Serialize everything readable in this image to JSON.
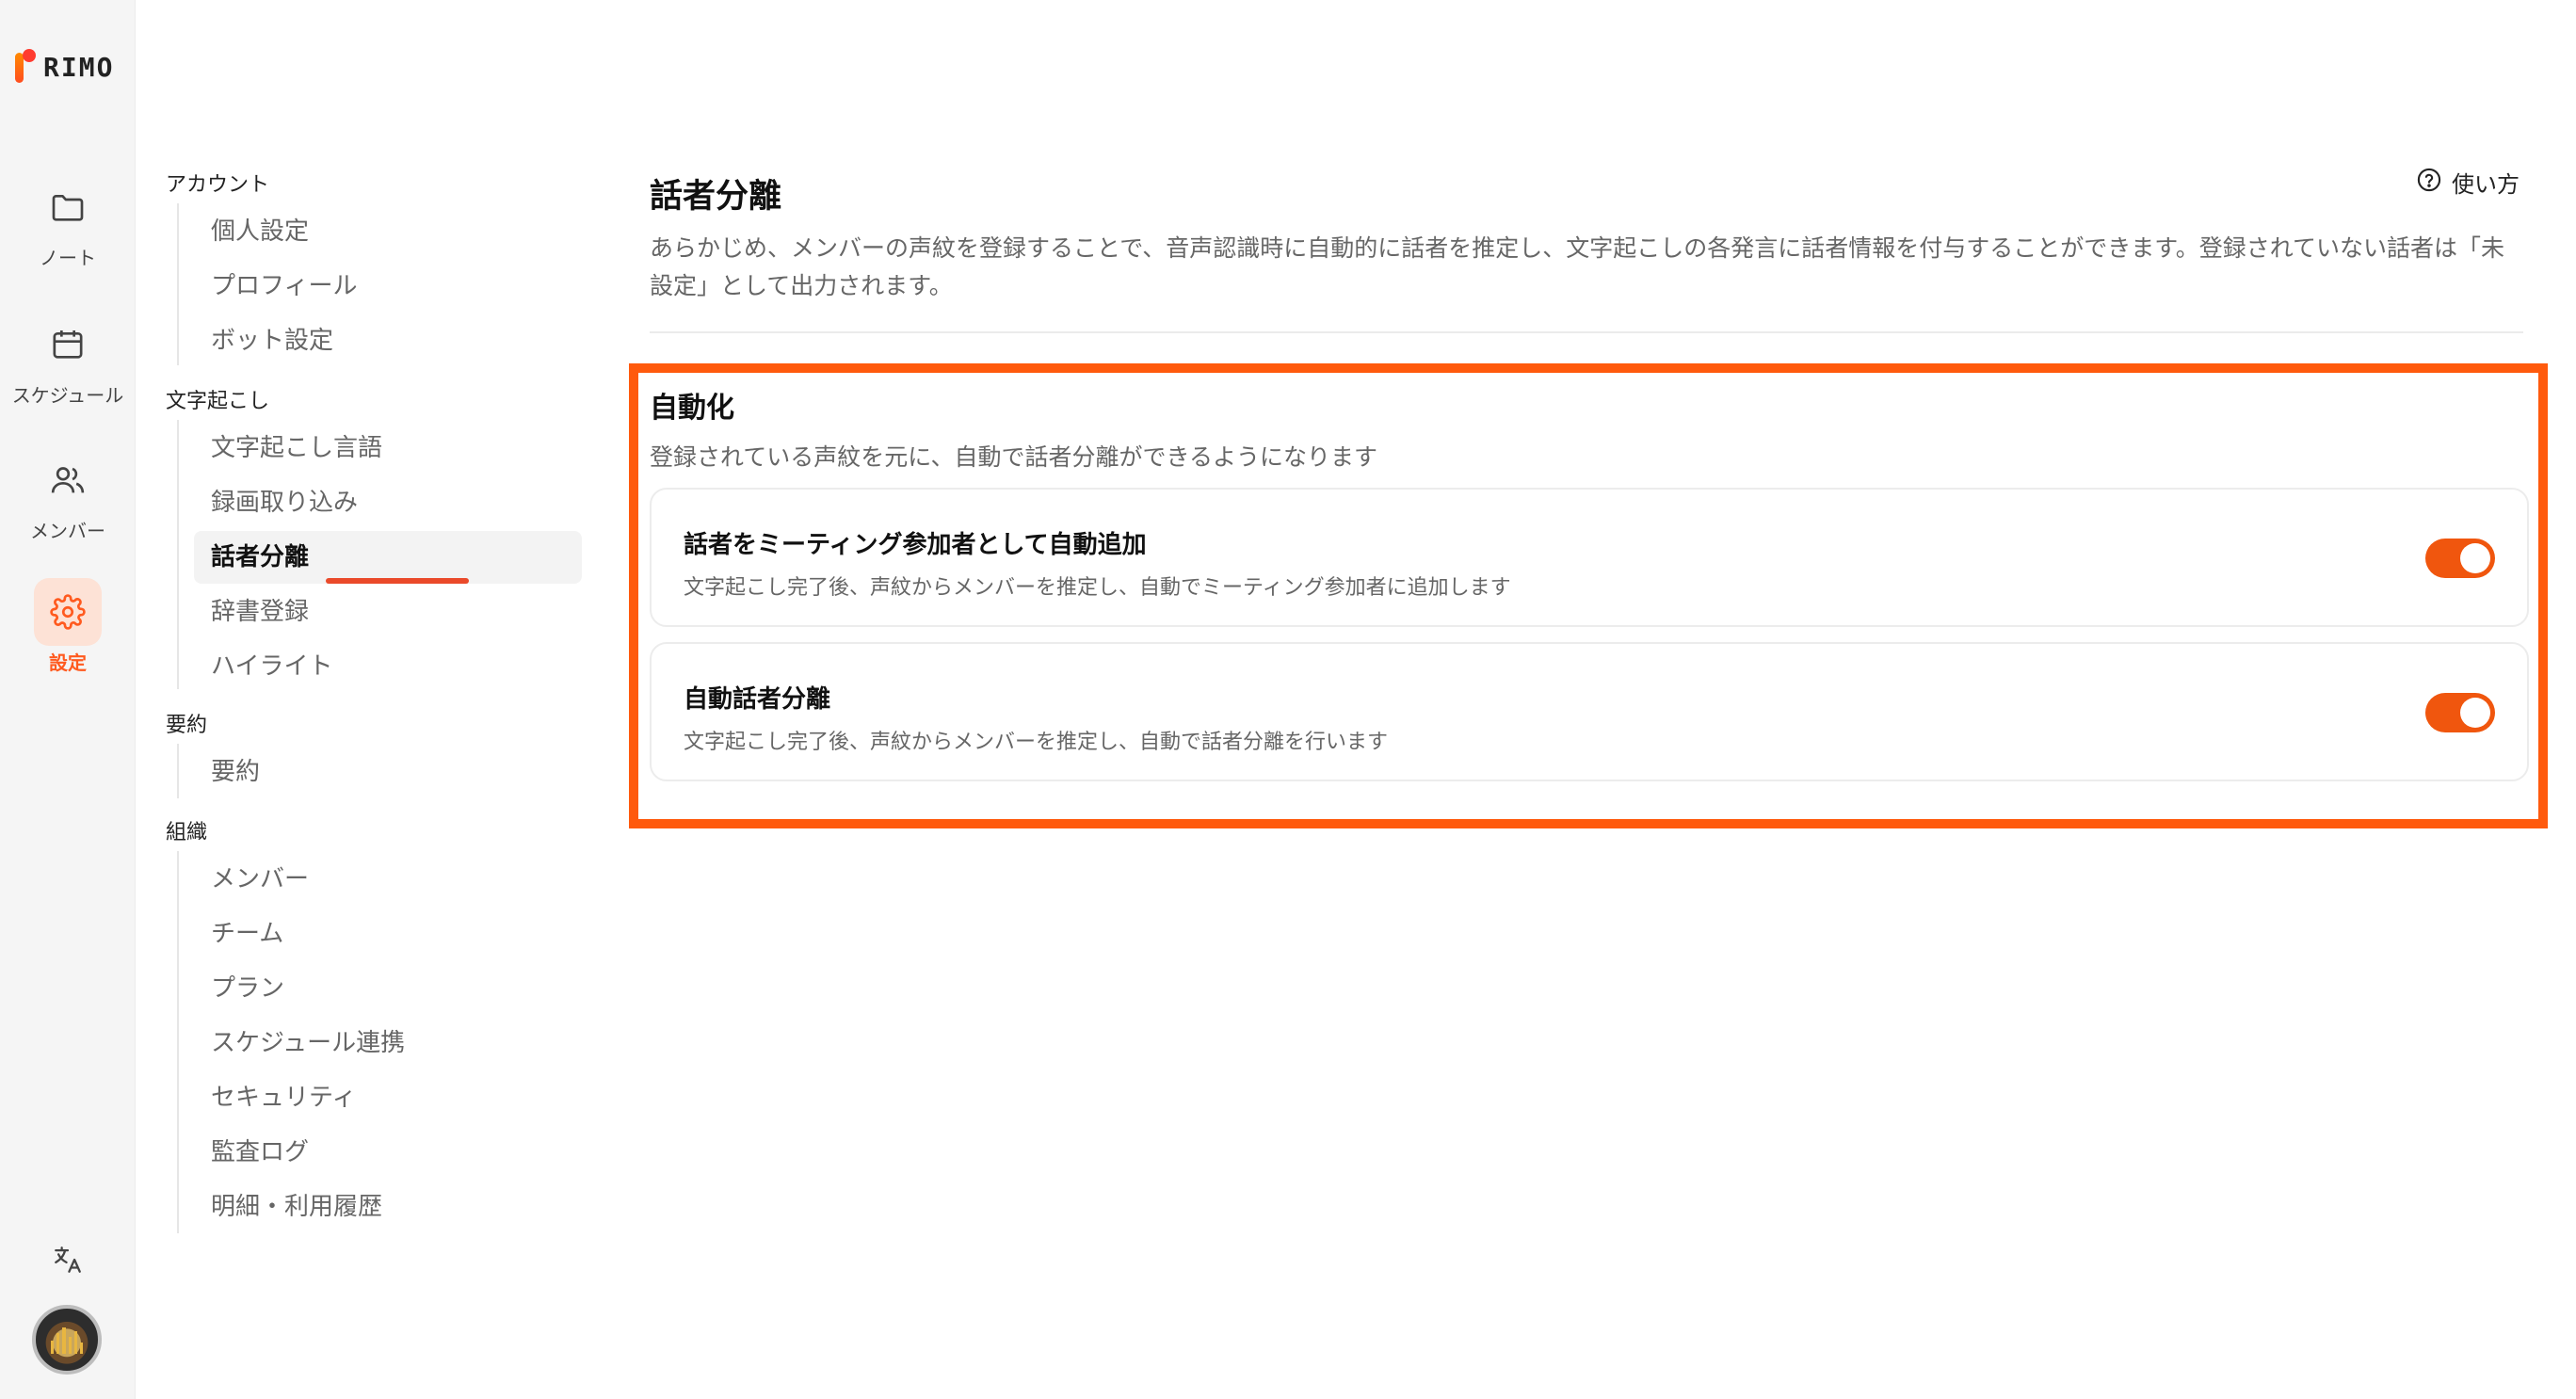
{
  "brand": {
    "name": "RIMO"
  },
  "rail": {
    "items": [
      {
        "label": "ノート",
        "icon": "folder-icon"
      },
      {
        "label": "スケジュール",
        "icon": "calendar-icon"
      },
      {
        "label": "メンバー",
        "icon": "users-icon"
      },
      {
        "label": "設定",
        "icon": "gear-icon",
        "active": true
      }
    ],
    "translate_icon": "translate-icon",
    "avatar_icon": "user-avatar"
  },
  "settings_nav": {
    "sections": [
      {
        "title": "アカウント",
        "items": [
          "個人設定",
          "プロフィール",
          "ボット設定"
        ]
      },
      {
        "title": "文字起こし",
        "items": [
          "文字起こし言語",
          "録画取り込み",
          "話者分離",
          "辞書登録",
          "ハイライト"
        ]
      },
      {
        "title": "要約",
        "items": [
          "要約"
        ]
      },
      {
        "title": "組織",
        "items": [
          "メンバー",
          "チーム",
          "プラン",
          "スケジュール連携",
          "セキュリティ",
          "監査ログ",
          "明細・利用履歴"
        ]
      }
    ],
    "active_item": "話者分離"
  },
  "main": {
    "title": "話者分離",
    "help_label": "使い方",
    "description": "あらかじめ、メンバーの声紋を登録することで、音声認識時に自動的に話者を推定し、文字起こしの各発言に話者情報を付与することができます。登録されていない話者は「未設定」として出力されます。",
    "automation": {
      "title": "自動化",
      "description": "登録されている声紋を元に、自動で話者分離ができるようになります",
      "cards": [
        {
          "title": "話者をミーティング参加者として自動追加",
          "description": "文字起こし完了後、声紋からメンバーを推定し、自動でミーティング参加者に追加します",
          "enabled": true
        },
        {
          "title": "自動話者分離",
          "description": "文字起こし完了後、声紋からメンバーを推定し、自動で話者分離を行います",
          "enabled": true
        }
      ]
    }
  },
  "colors": {
    "accent": "#ff5a1f",
    "toggle_on": "#f0560e",
    "highlight_border": "#ff5a0d",
    "underline": "#ea4a2a"
  }
}
